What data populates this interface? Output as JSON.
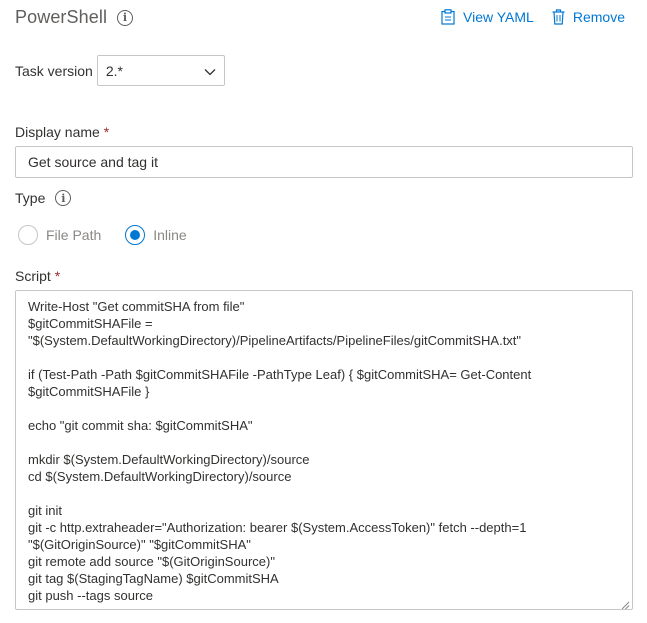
{
  "header": {
    "title": "PowerShell",
    "info_icon": "info-icon",
    "actions": [
      {
        "label": "View YAML",
        "icon": "clipboard-icon"
      },
      {
        "label": "Remove",
        "icon": "trash-icon"
      }
    ]
  },
  "task_version": {
    "label": "Task version",
    "value": "2.*"
  },
  "display_name": {
    "label": "Display name",
    "required_mark": "*",
    "value": "Get source and tag it"
  },
  "type": {
    "label": "Type",
    "options": [
      {
        "label": "File Path",
        "selected": false
      },
      {
        "label": "Inline",
        "selected": true
      }
    ]
  },
  "script": {
    "label": "Script",
    "required_mark": "*",
    "lines": [
      "Write-Host \"Get commitSHA from file\"",
      "$gitCommitSHAFile =",
      "\"$(System.DefaultWorkingDirectory)/PipelineArtifacts/PipelineFiles/gitCommitSHA.txt\"",
      "",
      "if (Test-Path -Path $gitCommitSHAFile -PathType Leaf) { $gitCommitSHA= Get-Content",
      "$gitCommitSHAFile }",
      "",
      "echo \"git commit sha: $gitCommitSHA\"",
      "",
      "mkdir $(System.DefaultWorkingDirectory)/source",
      "cd $(System.DefaultWorkingDirectory)/source",
      "",
      "git init",
      "git -c http.extraheader=\"Authorization: bearer $(System.AccessToken)\" fetch --depth=1",
      "\"$(GitOriginSource)\" \"$gitCommitSHA\"",
      "git remote add source \"$(GitOriginSource)\"",
      "git tag $(StagingTagName) $gitCommitSHA",
      "git push --tags source"
    ]
  },
  "colors": {
    "accent": "#0078d4",
    "required": "#a4262c",
    "border": "#c8c6c4"
  }
}
